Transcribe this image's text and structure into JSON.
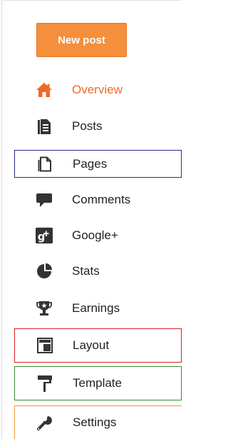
{
  "new_post_label": "New post",
  "nav": [
    {
      "label": "Overview",
      "icon": "home-icon",
      "active": true
    },
    {
      "label": "Posts",
      "icon": "posts-icon"
    },
    {
      "label": "Pages",
      "icon": "pages-icon"
    },
    {
      "label": "Comments",
      "icon": "comment-icon"
    },
    {
      "label": "Google+",
      "icon": "google-plus-icon"
    },
    {
      "label": "Stats",
      "icon": "stats-icon"
    },
    {
      "label": "Earnings",
      "icon": "trophy-icon"
    },
    {
      "label": "Layout",
      "icon": "layout-icon"
    },
    {
      "label": "Template",
      "icon": "paint-roller-icon"
    },
    {
      "label": "Settings",
      "icon": "wrench-icon"
    }
  ],
  "colors": {
    "accent": "#f58f3c",
    "active_text": "#ee6a26",
    "outline_blue": "#2b2b8f",
    "outline_red": "#d82222",
    "outline_green": "#3a8a3a",
    "outline_orange": "#f39b2d"
  }
}
